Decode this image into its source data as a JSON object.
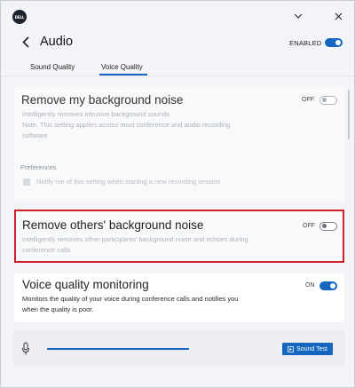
{
  "titlebar": {
    "logo_text": "DELL",
    "minimize_icon": "chevron-down-icon",
    "close_icon": "close-icon"
  },
  "header": {
    "title": "Audio",
    "enabled_label": "ENABLED",
    "enabled": true
  },
  "tabs": [
    {
      "label": "Sound Quality",
      "active": false
    },
    {
      "label": "Voice Quality",
      "active": true
    }
  ],
  "settings": {
    "remove_my_noise": {
      "title": "Remove my background noise",
      "description_line1": "Intelligently removes intrusive background sounds",
      "description_line2": "Note: This setting applies across most conference and audio recording",
      "description_line3": "software",
      "state_label": "OFF",
      "enabled": false
    },
    "preferences": {
      "label": "Preferences",
      "notify_label": "Notify me of this setting when starting a new recording session",
      "checked": false
    },
    "remove_others_noise": {
      "title": "Remove others' background noise",
      "description_line1": "Intelligently removes other participants' background noise and echoes during",
      "description_line2": "conference calls",
      "state_label": "OFF",
      "enabled": false,
      "highlight_color": "#d0202a"
    },
    "voice_monitoring": {
      "title": "Voice quality monitoring",
      "description_line1": "Monitors the quality of your voice during conference calls and notifies you",
      "description_line2": "when the quality is poor.",
      "state_label": "ON",
      "enabled": true
    }
  },
  "bottom_bar": {
    "mic_icon": "microphone-icon",
    "level_fraction": 1.0,
    "sound_test_label": "Sound Test",
    "sound_test_icon": "play-icon"
  },
  "colors": {
    "accent": "#1466c1",
    "highlight": "#d0202a"
  }
}
